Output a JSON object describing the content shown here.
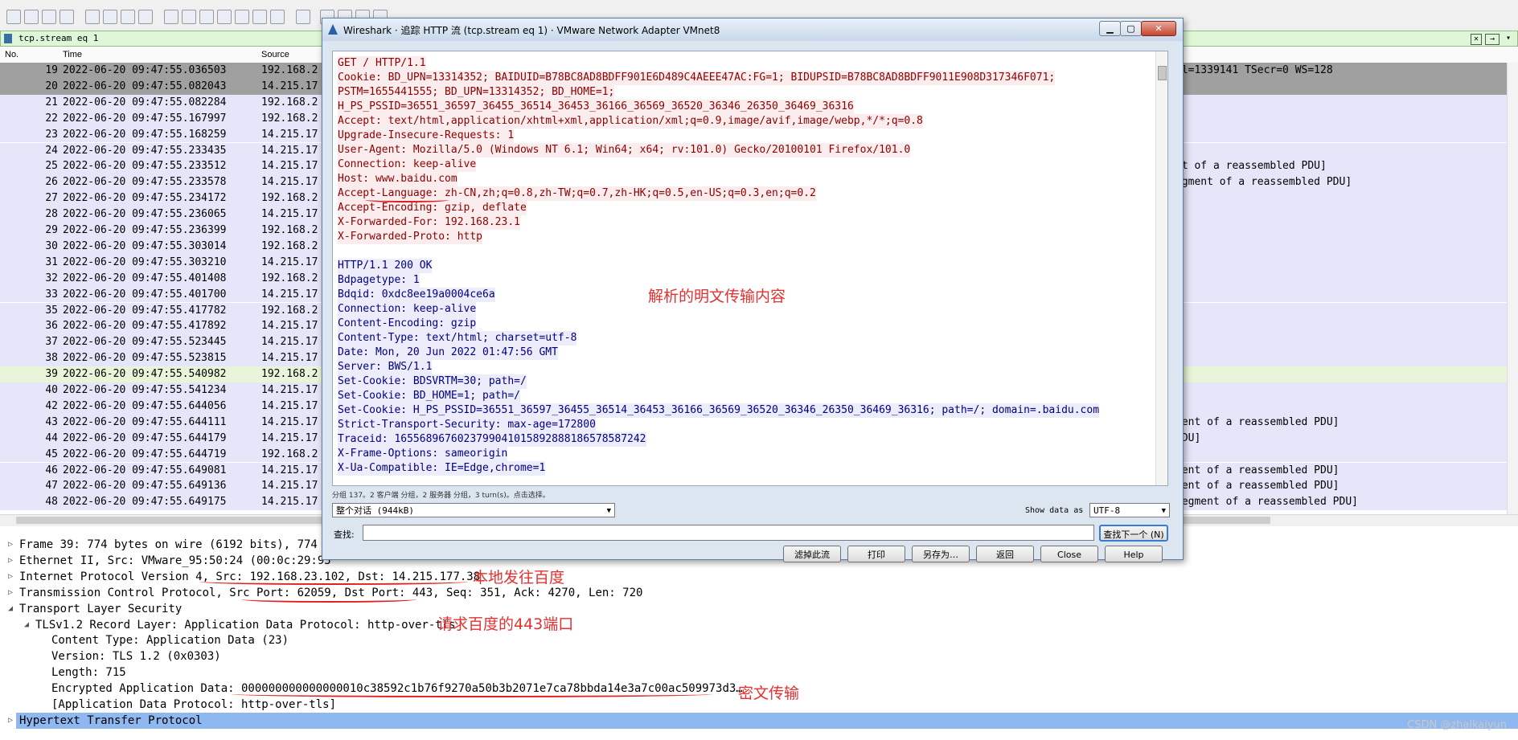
{
  "filter": {
    "value": "tcp.stream eq 1"
  },
  "packet_list": {
    "columns": [
      "No.",
      "Time",
      "Source"
    ],
    "rows": [
      {
        "no": "19",
        "time": "2022-06-20 09:47:55.036503",
        "src": "192.168.2",
        "info": "al=1339141 TSecr=0 WS=128"
      },
      {
        "no": "20",
        "time": "2022-06-20 09:47:55.082043",
        "src": "14.215.17",
        "info": ""
      },
      {
        "no": "21",
        "time": "2022-06-20 09:47:55.082284",
        "src": "192.168.2",
        "info": ""
      },
      {
        "no": "22",
        "time": "2022-06-20 09:47:55.167997",
        "src": "192.168.2",
        "info": ""
      },
      {
        "no": "23",
        "time": "2022-06-20 09:47:55.168259",
        "src": "14.215.17",
        "info": ""
      },
      {
        "no": "24",
        "time": "2022-06-20 09:47:55.233435",
        "src": "14.215.17",
        "info": ""
      },
      {
        "no": "25",
        "time": "2022-06-20 09:47:55.233512",
        "src": "14.215.17",
        "info": "nt of a reassembled PDU]"
      },
      {
        "no": "26",
        "time": "2022-06-20 09:47:55.233578",
        "src": "14.215.17",
        "info": "egment of a reassembled PDU]"
      },
      {
        "no": "27",
        "time": "2022-06-20 09:47:55.234172",
        "src": "192.168.2",
        "info": ""
      },
      {
        "no": "28",
        "time": "2022-06-20 09:47:55.236065",
        "src": "14.215.17",
        "info": ""
      },
      {
        "no": "29",
        "time": "2022-06-20 09:47:55.236399",
        "src": "192.168.2",
        "info": ""
      },
      {
        "no": "30",
        "time": "2022-06-20 09:47:55.303014",
        "src": "192.168.2",
        "info": ""
      },
      {
        "no": "31",
        "time": "2022-06-20 09:47:55.303210",
        "src": "14.215.17",
        "info": ""
      },
      {
        "no": "32",
        "time": "2022-06-20 09:47:55.401408",
        "src": "192.168.2",
        "info": ""
      },
      {
        "no": "33",
        "time": "2022-06-20 09:47:55.401700",
        "src": "14.215.17",
        "info": ""
      },
      {
        "no": "35",
        "time": "2022-06-20 09:47:55.417782",
        "src": "192.168.2",
        "info": ""
      },
      {
        "no": "36",
        "time": "2022-06-20 09:47:55.417892",
        "src": "14.215.17",
        "info": ""
      },
      {
        "no": "37",
        "time": "2022-06-20 09:47:55.523445",
        "src": "14.215.17",
        "info": ""
      },
      {
        "no": "38",
        "time": "2022-06-20 09:47:55.523815",
        "src": "14.215.17",
        "info": ""
      },
      {
        "no": "39",
        "time": "2022-06-20 09:47:55.540982",
        "src": "192.168.2",
        "info": ""
      },
      {
        "no": "40",
        "time": "2022-06-20 09:47:55.541234",
        "src": "14.215.17",
        "info": ""
      },
      {
        "no": "42",
        "time": "2022-06-20 09:47:55.644056",
        "src": "14.215.17",
        "info": ""
      },
      {
        "no": "43",
        "time": "2022-06-20 09:47:55.644111",
        "src": "14.215.17",
        "info": "nent of a reassembled PDU]"
      },
      {
        "no": "44",
        "time": "2022-06-20 09:47:55.644179",
        "src": "14.215.17",
        "info": "PDU]"
      },
      {
        "no": "45",
        "time": "2022-06-20 09:47:55.644719",
        "src": "192.168.2",
        "info": ""
      },
      {
        "no": "46",
        "time": "2022-06-20 09:47:55.649081",
        "src": "14.215.17",
        "info": "nent of a reassembled PDU]"
      },
      {
        "no": "47",
        "time": "2022-06-20 09:47:55.649136",
        "src": "14.215.17",
        "info": "nent of a reassembled PDU]"
      },
      {
        "no": "48",
        "time": "2022-06-20 09:47:55.649175",
        "src": "14.215.17",
        "info": "segment of a reassembled PDU]"
      }
    ]
  },
  "details": [
    {
      "text": "Frame 39: 774 bytes on wire (6192 bits), 774 by",
      "arrow": "▷"
    },
    {
      "text": "Ethernet II, Src: VMware_95:50:24 (00:0c:29:95",
      "arrow": "▷"
    },
    {
      "text": "Internet Protocol Version 4, Src: 192.168.23.102, Dst: 14.215.177.38",
      "arrow": "▷"
    },
    {
      "text": "Transmission Control Protocol, Src Port: 62059, Dst Port: 443, Seq: 351, Ack: 4270, Len: 720",
      "arrow": "▷"
    },
    {
      "text": "Transport Layer Security",
      "arrow": "◢"
    },
    {
      "text": "TLSv1.2 Record Layer: Application Data Protocol: http-over-tls",
      "arrow": "◢"
    },
    {
      "text": "Content Type: Application Data (23)",
      "arrow": ""
    },
    {
      "text": "Version: TLS 1.2 (0x0303)",
      "arrow": ""
    },
    {
      "text": "Length: 715",
      "arrow": ""
    },
    {
      "text": "Encrypted Application Data: 000000000000000010c38592c1b76f9270a50b3b2071e7ca78bbda14e3a7c00ac509973d3…",
      "arrow": ""
    },
    {
      "text": "[Application Data Protocol: http-over-tls]",
      "arrow": ""
    },
    {
      "text": "Hypertext Transfer Protocol",
      "arrow": "▷"
    }
  ],
  "annotations": {
    "local_to_baidu": "本地发往百度",
    "port_443": "请求百度的443端口",
    "ciphertext": "密文传输",
    "plaintext": "解析的明文传输内容"
  },
  "watermark": "CSDN @zhaikaiyun",
  "dialog": {
    "title": "Wireshark · 追踪 HTTP 流 (tcp.stream eq 1) · VMware Network Adapter VMnet8",
    "client_lines": [
      "GET / HTTP/1.1",
      "Cookie: BD_UPN=13314352; BAIDUID=B78BC8AD8BDFF901E6D489C4AEEE47AC:FG=1; BIDUPSID=B78BC8AD8BDFF9011E908D317346F071;",
      "PSTM=1655441555; BD_UPN=13314352; BD_HOME=1;",
      "H_PS_PSSID=36551_36597_36455_36514_36453_36166_36569_36520_36346_26350_36469_36316",
      "Accept: text/html,application/xhtml+xml,application/xml;q=0.9,image/avif,image/webp,*/*;q=0.8",
      "Upgrade-Insecure-Requests: 1",
      "User-Agent: Mozilla/5.0 (Windows NT 6.1; Win64; x64; rv:101.0) Gecko/20100101 Firefox/101.0",
      "Connection: keep-alive",
      "Host: www.baidu.com",
      "Accept-Language: zh-CN,zh;q=0.8,zh-TW;q=0.7,zh-HK;q=0.5,en-US;q=0.3,en;q=0.2",
      "Accept-Encoding: gzip, deflate",
      "X-Forwarded-For: 192.168.23.1",
      "X-Forwarded-Proto: http"
    ],
    "server_lines": [
      "HTTP/1.1 200 OK",
      "Bdpagetype: 1",
      "Bdqid: 0xdc8ee19a0004ce6a",
      "Connection: keep-alive",
      "Content-Encoding: gzip",
      "Content-Type: text/html; charset=utf-8",
      "Date: Mon, 20 Jun 2022 01:47:56 GMT",
      "Server: BWS/1.1",
      "Set-Cookie: BDSVRTM=30; path=/",
      "Set-Cookie: BD_HOME=1; path=/",
      "Set-Cookie: H_PS_PSSID=36551_36597_36455_36514_36453_36166_36569_36520_36346_26350_36469_36316; path=/; domain=.baidu.com",
      "Strict-Transport-Security: max-age=172800",
      "Traceid: 1655689676023799041015892888186578587242",
      "X-Frame-Options: sameorigin",
      "X-Ua-Compatible: IE=Edge,chrome=1"
    ],
    "stats": "分组 137。2 客户端 分组，2 服务器 分组，3 turn(s)。点击选择。",
    "conversation_select": "整个对话 (944kB)",
    "show_data_label": "Show data as",
    "show_data_value": "UTF-8",
    "find_label": "查找:",
    "find_value": "",
    "find_next": "查找下一个 (N)",
    "buttons": [
      "滤掉此流",
      "打印",
      "另存为…",
      "返回",
      "Close",
      "Help"
    ]
  },
  "colors": {
    "client_text": "#8b0000",
    "server_text": "#00007f",
    "annotation": "#e53030",
    "selected_row": "#90b8f0"
  }
}
